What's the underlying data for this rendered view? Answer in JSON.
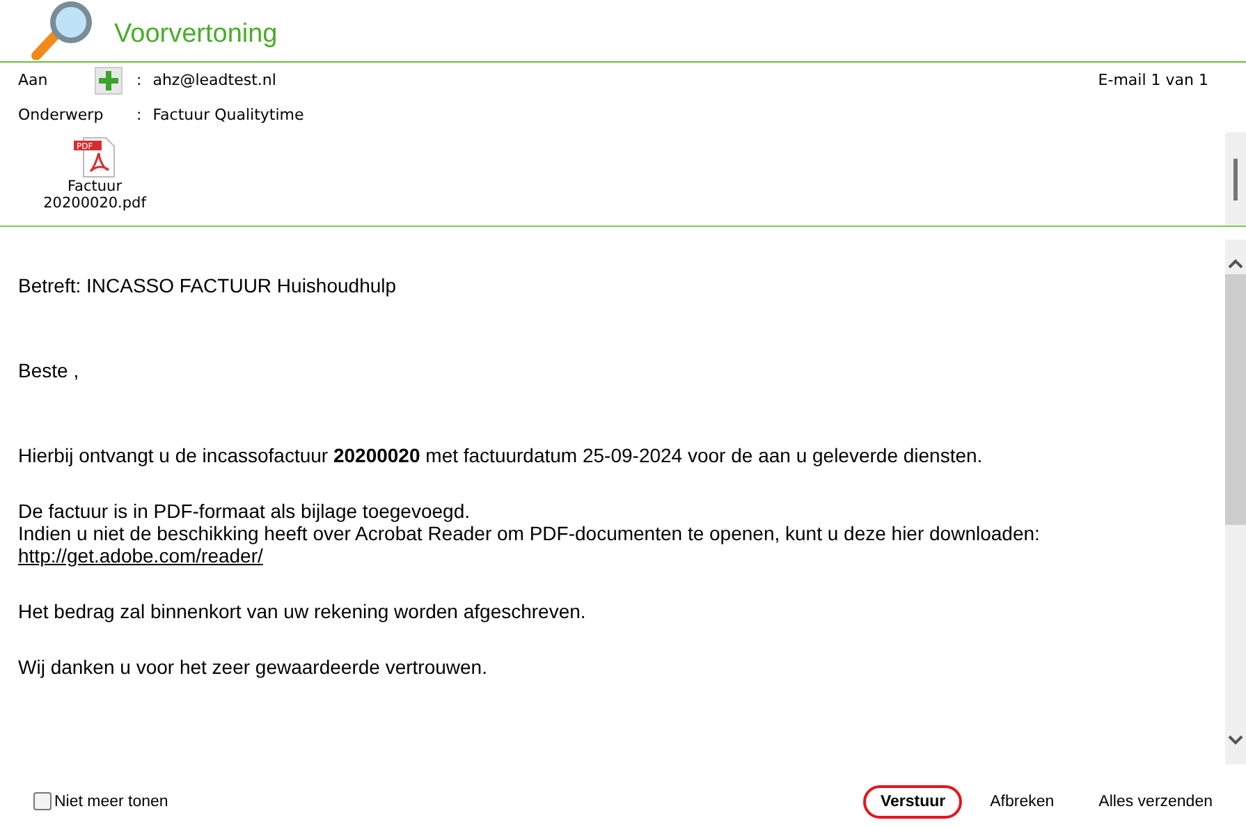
{
  "header": {
    "title": "Voorvertoning"
  },
  "fields": [
    {
      "label": "Aan",
      "separator": ":",
      "value": "ahz@leadtest.nl",
      "has_add": true
    },
    {
      "label": "Onderwerp",
      "separator": ":",
      "value": "Factuur Qualitytime",
      "has_add": false
    }
  ],
  "counter": "E-mail 1 van 1",
  "attachments": [
    {
      "name": "Factuur 20200020.pdf",
      "badge": "PDF"
    }
  ],
  "body": {
    "heading": "Betreft: INCASSO FACTUUR Huishoudhulp",
    "salutation": "Beste ,",
    "paragraphs": [
      {
        "lines": [
          {
            "kind": "text",
            "text": "Hierbij ontvangt u de incassofactuur **20200020** met factuurdatum 25-09-2024 voor de aan u geleverde diensten."
          }
        ]
      },
      {
        "lines": [
          {
            "kind": "text",
            "text": "De factuur is in PDF-formaat als bijlage toegevoegd."
          },
          {
            "kind": "text",
            "text": "Indien u niet de beschikking heeft over Acrobat Reader om PDF-documenten te openen, kunt u deze hier downloaden:"
          },
          {
            "kind": "link",
            "text": "http://get.adobe.com/reader/"
          }
        ]
      },
      {
        "lines": [
          {
            "kind": "text",
            "text": "Het bedrag zal binnenkort van uw rekening worden afgeschreven."
          }
        ]
      },
      {
        "lines": [
          {
            "kind": "text",
            "text": "Wij danken u voor het zeer gewaardeerde vertrouwen."
          }
        ]
      }
    ]
  },
  "footer": {
    "checkbox": {
      "label": "Niet meer tonen",
      "checked": false
    },
    "buttons": [
      {
        "label": "Verstuur",
        "selected": true
      },
      {
        "label": "Afbreken",
        "selected": false
      },
      {
        "label": "Alles verzenden",
        "selected": false
      }
    ]
  }
}
